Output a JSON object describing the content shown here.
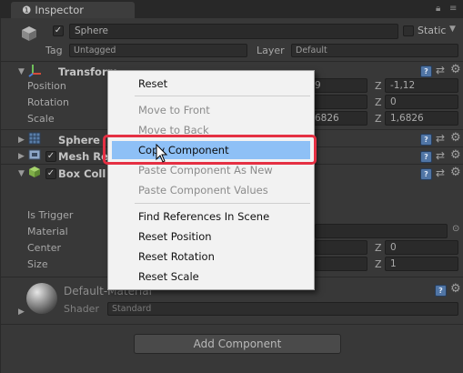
{
  "tab": {
    "title": "Inspector"
  },
  "object": {
    "name": "Sphere",
    "static_label": "Static",
    "tag_label": "Tag",
    "tag_value": "Untagged",
    "layer_label": "Layer",
    "layer_value": "Default"
  },
  "transform": {
    "title": "Transform",
    "position_label": "Position",
    "rotation_label": "Rotation",
    "scale_label": "Scale",
    "position_y_partial": "9",
    "position_z": "-1,12",
    "rotation_z": "0",
    "scale_y_partial": "6826",
    "scale_z": "1,6826",
    "axis_z": "Z"
  },
  "components": {
    "sphere_title": "Sphere",
    "mesh_title": "Mesh Re",
    "box_title": "Box Coll"
  },
  "box_collider": {
    "is_trigger_label": "Is Trigger",
    "material_label": "Material",
    "center_label": "Center",
    "size_label": "Size",
    "center_z": "0",
    "size_z": "1",
    "axis_z": "Z"
  },
  "material": {
    "name": "Default-Material",
    "shader_label": "Shader",
    "shader_value": "Standard"
  },
  "add_component_label": "Add Component",
  "context_menu": {
    "items": [
      {
        "label": "Reset",
        "enabled": true
      },
      {
        "label": "Move to Front",
        "enabled": false
      },
      {
        "label": "Move to Back",
        "enabled": false
      },
      {
        "label": "Copy Component",
        "enabled": true,
        "highlighted": true
      },
      {
        "label": "Paste Component As New",
        "enabled": false
      },
      {
        "label": "Paste Component Values",
        "enabled": false
      },
      {
        "label": "Find References In Scene",
        "enabled": true
      },
      {
        "label": "Reset Position",
        "enabled": true
      },
      {
        "label": "Reset Rotation",
        "enabled": true
      },
      {
        "label": "Reset Scale",
        "enabled": true
      }
    ]
  },
  "colors": {
    "highlight": "#8ec0f6",
    "annotation_box": "#e53043",
    "panel_bg": "#383838"
  }
}
